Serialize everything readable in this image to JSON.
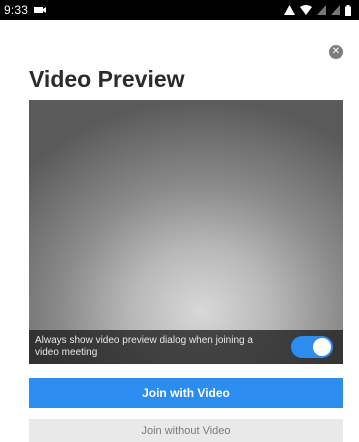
{
  "status_bar": {
    "time": "9:33",
    "icons_left": [
      "notification-icon"
    ],
    "icons_right": [
      "alert-icon",
      "wifi-icon",
      "signal-icon",
      "signal-icon",
      "battery-icon"
    ]
  },
  "dialog": {
    "title": "Video Preview",
    "close_icon": "close-icon",
    "preview": {
      "always_show_label": "Always show video preview dialog when joining a video meeting",
      "toggle_on": true
    },
    "join_with_video_label": "Join with Video",
    "join_without_video_label": "Join without Video"
  },
  "colors": {
    "accent": "#2d8cf0",
    "status_bar": "#000000",
    "secondary_button": "#e9e9e9",
    "title_text": "#2b2b2b"
  }
}
